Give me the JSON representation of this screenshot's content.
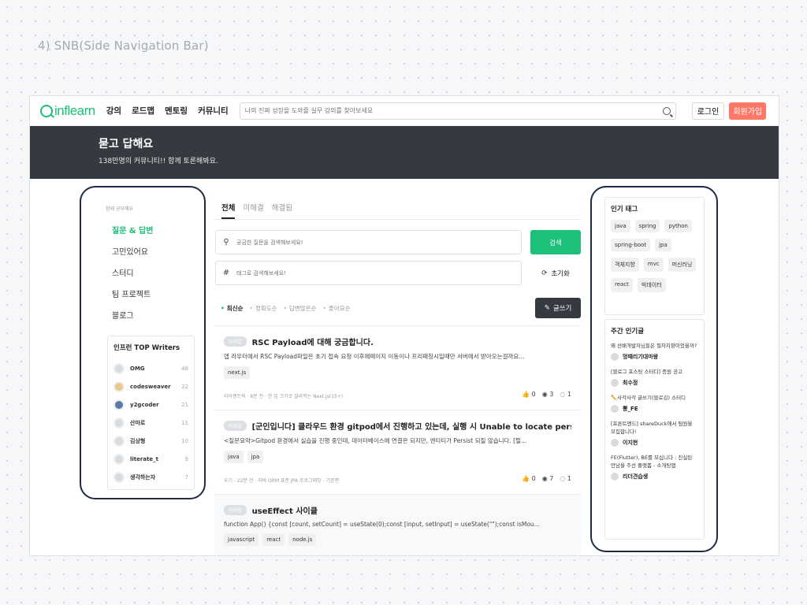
{
  "section_title": "4) SNB(Side Navigation Bar)",
  "header": {
    "logo": "inflearn",
    "nav": [
      "강의",
      "로드맵",
      "멘토링",
      "커뮤니티"
    ],
    "search_placeholder": "나의 진짜 성장을 도와줄 실무 강의를 찾아보세요",
    "login": "로그인",
    "signup": "회원가입",
    "accent": "#1dc078",
    "signup_color": "#ff7867"
  },
  "banner": {
    "title": "묻고 답해요",
    "subtitle": "138만명의 커뮤니티!! 함께 토론해봐요."
  },
  "left_sidebar": {
    "caption": "함께 공부해요",
    "menu": [
      "질문 & 답변",
      "고민있어요",
      "스터디",
      "팀 프로젝트",
      "블로그"
    ],
    "writers_title": "인프런 TOP Writers",
    "writers": [
      {
        "name": "OMG",
        "score": "48"
      },
      {
        "name": "codesweaver",
        "score": "22"
      },
      {
        "name": "y2gcoder",
        "score": "21"
      },
      {
        "name": "산마로",
        "score": "11"
      },
      {
        "name": "김상형",
        "score": "10"
      },
      {
        "name": "literate_t",
        "score": "9"
      },
      {
        "name": "생각하는자",
        "score": "7"
      }
    ]
  },
  "center": {
    "tabs": [
      "전체",
      "미해결",
      "해결됨"
    ],
    "question_placeholder": "궁금한 질문을 검색해보세요!",
    "tag_placeholder": "태그로 검색해보세요!",
    "search_button": "검색",
    "reset_button": "초기화",
    "sort": [
      "최신순",
      "정확도순",
      "답변많은순",
      "좋아요순"
    ],
    "write_button": "글쓰기",
    "posts": [
      {
        "badge": "미해결",
        "title": "RSC Payload에 대해 궁금합니다.",
        "body": "앱 라우터에서 RSC Payload파일은 초기 접속 요청 이후에페이지 이동이나 프리패칭시일때만 서버에서 받아오는걸까요...",
        "tags": [
          "next.js"
        ],
        "meta": "라아켄트릭 · 8분 전 · 한 입 크기로 잘라먹는 Next.js(15+)",
        "likes": "0",
        "views": "3",
        "comments": "1"
      },
      {
        "badge": "미해결",
        "title": "[군인입니다] 클라우드 환경 gitpod에서 진행하고 있는데, 실행 시 Unable to locate persist...",
        "body": "<질문요약>Gitpod 환경에서 실습을 진행 중인데, 데이터베이스에 연결은 되지만, 엔티티가 Persist 되질 않습니다. [필...",
        "tags": [
          "java",
          "jpa"
        ],
        "meta": "우기 · 22분 전 · 자바 ORM 표준 JPA 프로그래밍 - 기본편",
        "likes": "0",
        "views": "7",
        "comments": "1"
      },
      {
        "badge": "미해결",
        "title": "useEffect 사이클",
        "body": "function App() {const [count, setCount] = useState(0);const [input, setInput] = useState(\"\");const isMou...",
        "tags": [
          "javascript",
          "react",
          "node.js"
        ]
      }
    ]
  },
  "right_sidebar": {
    "tags_title": "인기 태그",
    "tags": [
      "java",
      "spring",
      "python",
      "spring-boot",
      "jpa",
      "객체지향",
      "mvc",
      "머신러닝",
      "react",
      "빅데이터"
    ],
    "weekly_title": "주간 인기글",
    "weekly": [
      {
        "q": "왜 선배개발자님들은 절차지향이었을까?",
        "user": "멍때리기대마왕"
      },
      {
        "q": "[블로그 포스팅 스터디] 증원 공고",
        "user": "최수정"
      },
      {
        "q": "✏️사각사각 글쓰기(블로깅) 스터디",
        "user": "뽕_FE"
      },
      {
        "q": "[프론트엔드] shareDuck에서 팀원을 모집합니다!",
        "user": "이지현"
      },
      {
        "q": "FE(Flutter), BE를 모십니다 : 진실된 만남을 주선 플랫폼 - 소개팅앱",
        "user": "리더견습생"
      }
    ]
  }
}
